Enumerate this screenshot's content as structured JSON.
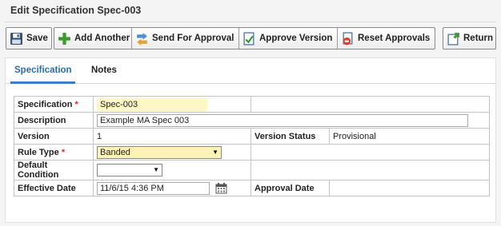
{
  "page": {
    "title": "Edit Specification Spec-003"
  },
  "toolbar": {
    "save_label": "Save",
    "add_another_label": "Add Another",
    "send_for_approval_label": "Send For Approval",
    "approve_version_label": "Approve Version",
    "reset_approvals_label": "Reset Approvals",
    "return_label": "Return"
  },
  "tabs": [
    {
      "label": "Specification",
      "active": true
    },
    {
      "label": "Notes",
      "active": false
    }
  ],
  "form": {
    "specification": {
      "label": "Specification",
      "required_mark": "*",
      "value": "Spec-003"
    },
    "description": {
      "label": "Description",
      "value": "Example MA Spec 003"
    },
    "version": {
      "label": "Version",
      "value": "1"
    },
    "version_status": {
      "label": "Version Status",
      "value": "Provisional"
    },
    "rule_type": {
      "label": "Rule Type",
      "required_mark": "*",
      "value": "Banded"
    },
    "default_condition": {
      "label": "Default Condition",
      "value": ""
    },
    "effective_date": {
      "label": "Effective Date",
      "value": "11/6/15 4:36 PM"
    },
    "approval_date": {
      "label": "Approval Date",
      "value": ""
    }
  },
  "colors": {
    "accent": "#2a6ebb",
    "required": "#d12b2b",
    "highlight_field": "#fdf7c3"
  },
  "icons": [
    "save-icon",
    "add-icon",
    "send-icon",
    "approve-icon",
    "reset-icon",
    "return-icon",
    "calendar-icon",
    "chevron-down-icon"
  ]
}
